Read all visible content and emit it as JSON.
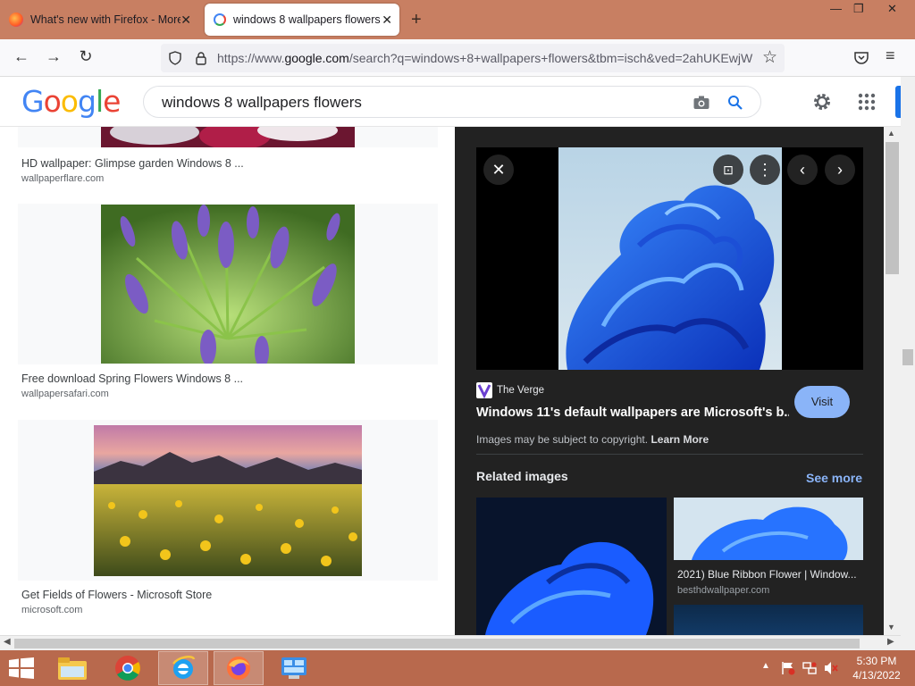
{
  "browser": {
    "tabs": [
      {
        "title": "What's new with Firefox - More",
        "active": false
      },
      {
        "title": "windows 8 wallpapers flowers -",
        "active": true
      }
    ],
    "new_tab_symbol": "+",
    "window_controls": [
      "—",
      "❐",
      "✕"
    ],
    "url_prefix": "https://www.",
    "url_domain": "google.com",
    "url_rest": "/search?q=windows+8+wallpapers+flowers&tbm=isch&ved=2ahUKEwjW"
  },
  "google": {
    "logo_letters": [
      "G",
      "o",
      "o",
      "g",
      "l",
      "e"
    ],
    "logo_colors": [
      "#4285f4",
      "#ea4335",
      "#fbbc05",
      "#4285f4",
      "#34a853",
      "#ea4335"
    ],
    "search_query": "windows 8 wallpapers flowers"
  },
  "results": [
    {
      "title": "HD wallpaper: Glimpse garden Windows 8 ...",
      "source": "wallpaperflare.com"
    },
    {
      "title": "Free download Spring Flowers Windows 8 ...",
      "source": "wallpapersafari.com"
    },
    {
      "title": "Get Fields of Flowers - Microsoft Store",
      "source": "microsoft.com"
    }
  ],
  "preview": {
    "site_name": "The Verge",
    "title": "Windows 11's default wallpapers are Microsoft's b...",
    "visit_label": "Visit",
    "copyright_text": "Images may be subject to copyright.",
    "learn_more": "Learn More",
    "related_heading": "Related images",
    "see_more": "See more",
    "related_caption": "2021) Blue Ribbon Flower | Window...",
    "related_source": "besthdwallpaper.com"
  },
  "taskbar": {
    "time": "5:30 PM",
    "date": "4/13/2022"
  },
  "colors": {
    "titlebar": "#c87f62",
    "taskbar": "#b8694d",
    "accent_blue": "#1a73e8",
    "visit_button": "#8ab4f8"
  }
}
